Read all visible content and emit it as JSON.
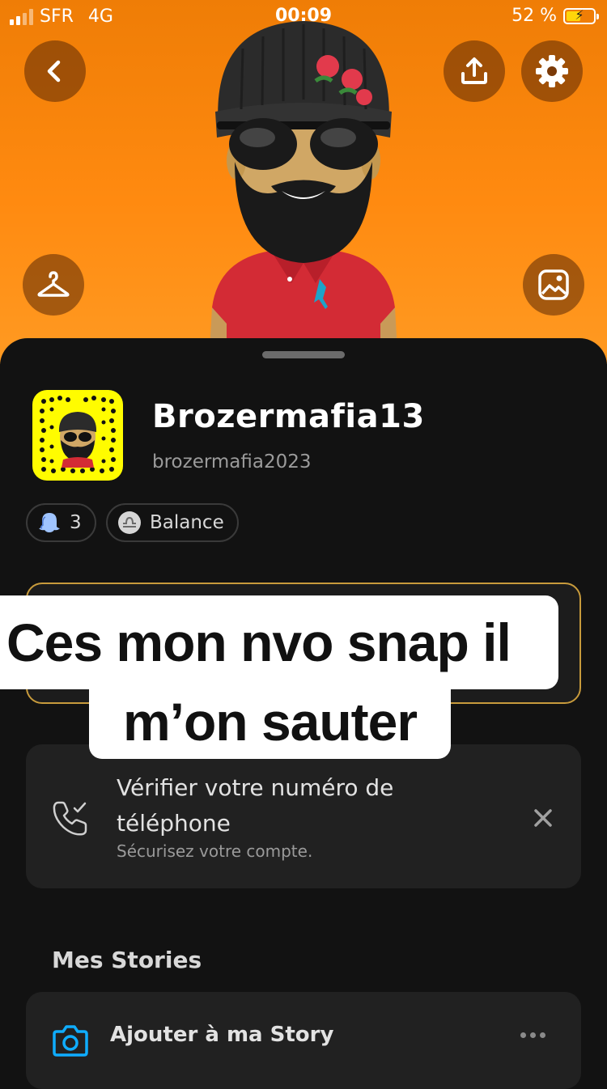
{
  "status_bar": {
    "carrier": "SFR",
    "network": "4G",
    "time": "00:09",
    "battery": "52 %",
    "battery_level": 0.52
  },
  "profile": {
    "display_name": "Brozermafia13",
    "username": "brozermafia2023"
  },
  "chips": {
    "friends_count": "3",
    "zodiac": "Balance"
  },
  "overlay_caption": {
    "line1": "Ces mon nvo snap il",
    "line2": "m’on sauter"
  },
  "verify_card": {
    "title": "Vérifier votre numéro de téléphone",
    "subtitle": "Sécurisez votre compte."
  },
  "stories": {
    "section_title": "Mes Stories",
    "add_label": "Ajouter à ma Story"
  },
  "colors": {
    "header_orange": "#ff8a10",
    "snap_yellow": "#fffc00",
    "gold_border": "#c89b3c",
    "sheet_bg": "#121212",
    "accent_blue": "#0fadff"
  },
  "icons": [
    "back-icon",
    "share-icon",
    "gear-icon",
    "hanger-icon",
    "sticker-icon",
    "ghost-icon",
    "zodiac-icon",
    "phone-check-icon",
    "close-icon",
    "camera-icon",
    "more-icon"
  ]
}
